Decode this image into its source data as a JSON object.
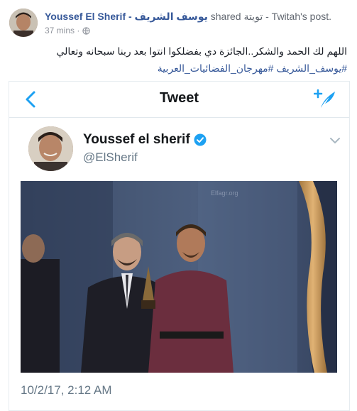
{
  "post": {
    "author": "Youssef El Sherif - يوسف الشريف",
    "shared_text": "shared تويتة - Twitah's post.",
    "time": "37 mins ·",
    "privacy_icon": "globe-icon",
    "text": "اللهم لك الحمد والشكر..الجائزة دي بفضلكوا انتوا بعد ربنا سبحانه وتعالي",
    "hashtags": "#يوسف_الشريف #مهرجان_الفضائيات_العربية"
  },
  "tweet": {
    "header_title": "Tweet",
    "back_icon": "chevron-left-icon",
    "compose_icon": "compose-tweet-icon",
    "display_name": "Youssef el sherif",
    "handle": "@ElSherif",
    "verified_icon": "verified-badge-icon",
    "menu_icon": "chevron-down-icon",
    "date": "10/2/17, 2:12 AM",
    "photo_watermark": "Elfagr.org"
  },
  "colors": {
    "link": "#365899",
    "twitter_blue": "#1da1f2",
    "muted": "#657786"
  }
}
